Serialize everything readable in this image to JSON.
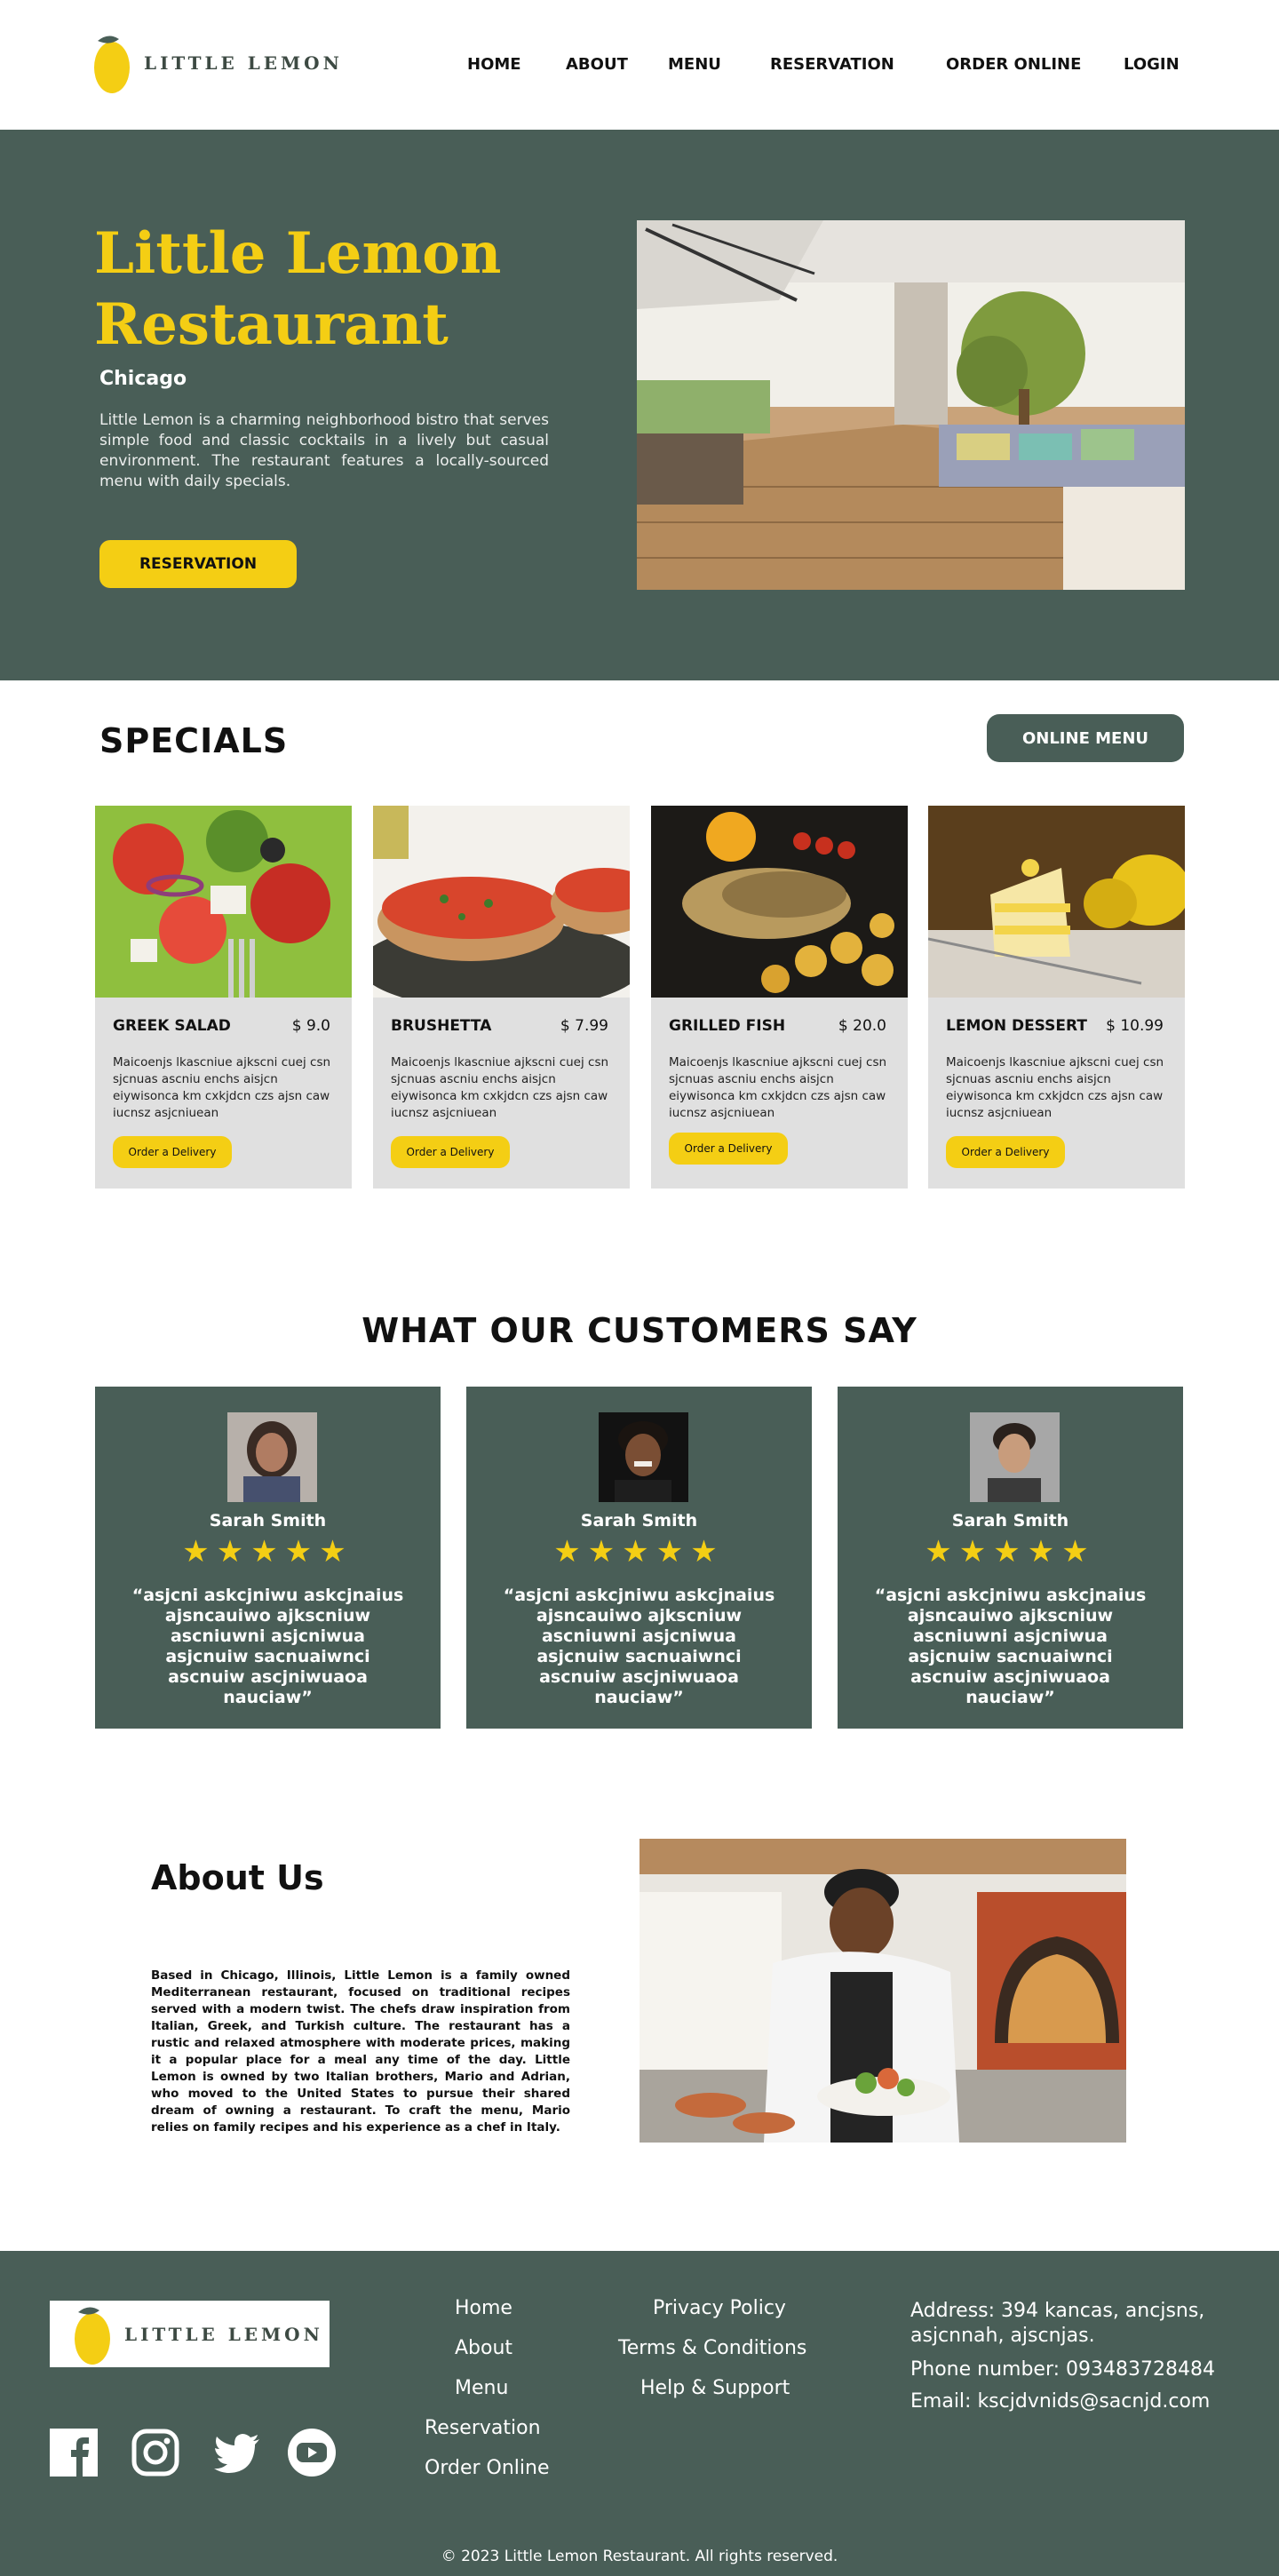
{
  "brand": {
    "name": "LITTLE LEMON",
    "accent": "#f4ce14",
    "primary": "#495e57"
  },
  "nav": {
    "items": [
      {
        "label": "HOME"
      },
      {
        "label": "ABOUT"
      },
      {
        "label": "MENU"
      },
      {
        "label": "RESERVATION"
      },
      {
        "label": "ORDER ONLINE"
      },
      {
        "label": "LOGIN"
      }
    ]
  },
  "hero": {
    "title_line1": "Little Lemon",
    "title_line2": "Restaurant",
    "subtitle": "Chicago",
    "description": "Little Lemon is a charming neighborhood bistro that serves simple food and classic cocktails in a lively but casual environment. The restaurant features a locally-sourced menu with daily specials.",
    "button": "RESERVATION"
  },
  "specials": {
    "title": "SPECIALS",
    "menu_button": "ONLINE MENU",
    "cards": [
      {
        "name": "GREEK SALAD",
        "price": "$ 9.0",
        "desc": "Maicoenjs lkascniue ajkscni cuej csn sjcnuas ascniu enchs aisjcn eiywisonca km cxkjdcn czs ajsn caw iucnsz asjcniuean",
        "button": "Order a Delivery"
      },
      {
        "name": "BRUSHETTA",
        "price": "$ 7.99",
        "desc": "Maicoenjs lkascniue ajkscni cuej csn sjcnuas ascniu enchs aisjcn eiywisonca km cxkjdcn czs ajsn caw iucnsz asjcniuean",
        "button": "Order a Delivery"
      },
      {
        "name": "GRILLED FISH",
        "price": "$ 20.0",
        "desc": "Maicoenjs lkascniue ajkscni cuej csn sjcnuas ascniu enchs aisjcn eiywisonca km cxkjdcn czs ajsn caw iucnsz asjcniuean",
        "button": "Order a Delivery"
      },
      {
        "name": "LEMON DESSERT",
        "price": "$ 10.99",
        "desc": "Maicoenjs lkascniue ajkscni cuej csn sjcnuas ascniu enchs aisjcn eiywisonca km cxkjdcn czs ajsn caw iucnsz asjcniuean",
        "button": "Order a Delivery"
      }
    ]
  },
  "testimonials": {
    "title": "WHAT OUR CUSTOMERS SAY",
    "cards": [
      {
        "name": "Sarah Smith",
        "rating": 5,
        "stars": "★★★★★",
        "quote": "“asjcni askcjniwu askcjnaius ajsncauiwo ajkscniuw ascniuwni asjcniwua asjcnuiw sacnuaiwnci ascnuiw ascjniwuaoa nauciaw”"
      },
      {
        "name": "Sarah Smith",
        "rating": 5,
        "stars": "★★★★★",
        "quote": "“asjcni askcjniwu askcjnaius ajsncauiwo ajkscniuw ascniuwni asjcniwua asjcnuiw sacnuaiwnci ascnuiw ascjniwuaoa nauciaw”"
      },
      {
        "name": "Sarah Smith",
        "rating": 5,
        "stars": "★★★★★",
        "quote": "“asjcni askcjniwu askcjnaius ajsncauiwo ajkscniuw ascniuwni asjcniwua asjcnuiw sacnuaiwnci ascnuiw ascjniwuaoa nauciaw”"
      }
    ]
  },
  "about": {
    "title": "About Us",
    "text": "Based in Chicago, Illinois, Little Lemon is a family owned Mediterranean restaurant, focused on traditional recipes served with a modern twist. The chefs draw inspiration from Italian, Greek, and Turkish culture. The restaurant has a rustic and relaxed atmosphere with moderate prices, making it a popular place for a meal any time of the day. Little Lemon is owned by two Italian brothers, Mario and Adrian, who moved to the United States to pursue their shared dream of owning a restaurant. To craft the menu, Mario relies on family recipes and his experience as a chef in Italy."
  },
  "footer": {
    "nav": [
      {
        "label": "Home"
      },
      {
        "label": "About"
      },
      {
        "label": "Menu"
      },
      {
        "label": "Reservation"
      },
      {
        "label": "Order Online"
      }
    ],
    "legal": [
      {
        "label": "Privacy Policy"
      },
      {
        "label": "Terms & Conditions"
      },
      {
        "label": "Help & Support"
      }
    ],
    "contact": {
      "address": "Address: 394 kancas, ancjsns, asjcnnah, ajscnjas.",
      "phone": "Phone number: 093483728484",
      "email": "Email: kscjdvnids@sacnjd.com"
    },
    "social": [
      "facebook-icon",
      "instagram-icon",
      "twitter-icon",
      "youtube-icon"
    ],
    "copyright": "© 2023 Little Lemon Restaurant. All rights reserved."
  }
}
